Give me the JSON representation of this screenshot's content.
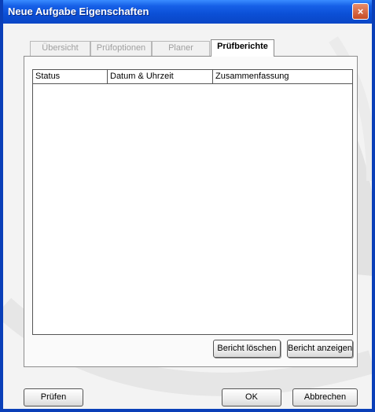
{
  "window": {
    "title": "Neue Aufgabe Eigenschaften",
    "close_glyph": "×"
  },
  "tabs": [
    {
      "label": "Übersicht",
      "active": false
    },
    {
      "label": "Prüfoptionen",
      "active": false
    },
    {
      "label": "Planer",
      "active": false
    },
    {
      "label": "Prüfberichte",
      "active": true
    }
  ],
  "report_list": {
    "columns": [
      "Status",
      "Datum & Uhrzeit",
      "Zusammenfassung"
    ],
    "rows": []
  },
  "panel_buttons": {
    "delete": "Bericht löschen",
    "show": "Bericht anzeigen"
  },
  "footer_buttons": {
    "check": "Prüfen",
    "ok": "OK",
    "cancel": "Abbrechen"
  },
  "colors": {
    "titlebar": "#0b4fd6",
    "frame": "#0a3fb8",
    "close": "#c64b24"
  }
}
